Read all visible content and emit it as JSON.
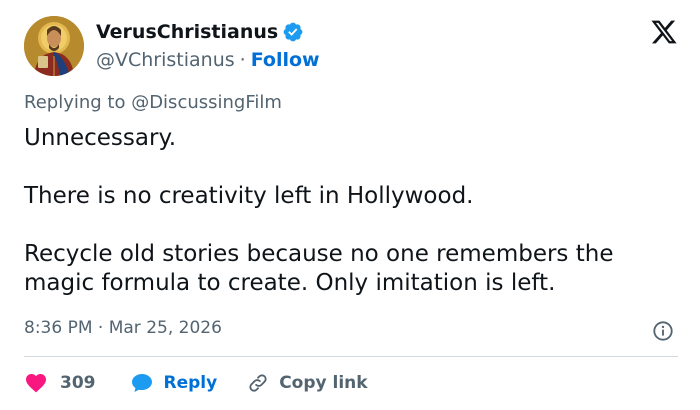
{
  "user": {
    "display_name": "VerusChristianus",
    "handle": "@VChristianus",
    "separator": "·",
    "follow_label": "Follow",
    "avatar_icon": "christ-pantocrator-icon",
    "verified_icon": "verified-badge-icon"
  },
  "platform_icon": "x-logo-icon",
  "reply_context": "Replying to @DiscussingFilm",
  "tweet": {
    "paragraphs": [
      "Unnecessary.",
      "There is no creativity left in Hollywood.",
      "Recycle old stories because no one remembers the magic formula to create. Only imitation is left."
    ]
  },
  "timestamp": "8:36 PM · Mar 25, 2026",
  "info_icon": "info-icon",
  "actions": {
    "like_count": "309",
    "reply_label": "Reply",
    "copy_label": "Copy link"
  },
  "colors": {
    "text": "#0f1419",
    "secondary": "#536471",
    "link": "#006fd6",
    "verified": "#1d9bf0",
    "like": "#f91880",
    "divider": "#cfd9de"
  }
}
